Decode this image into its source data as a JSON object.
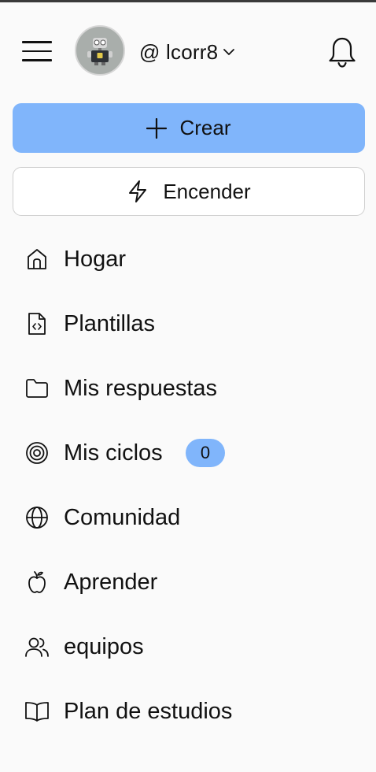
{
  "header": {
    "menu_icon": "hamburger-menu-icon",
    "avatar_icon": "robot-avatar-icon",
    "username": "@ lcorr8",
    "dropdown_icon": "chevron-down-icon",
    "notifications_icon": "bell-icon"
  },
  "actions": {
    "create_label": "Crear",
    "create_icon": "plus-icon",
    "power_label": "Encender",
    "power_icon": "lightning-bolt-icon",
    "accent_color": "#80b5fb"
  },
  "nav": {
    "items": [
      {
        "label": "Hogar",
        "icon": "home-icon"
      },
      {
        "label": "Plantillas",
        "icon": "code-file-icon"
      },
      {
        "label": "Mis respuestas",
        "icon": "folder-icon"
      },
      {
        "label": "Mis ciclos",
        "icon": "spiral-icon",
        "badge": "0"
      },
      {
        "label": "Comunidad",
        "icon": "globe-icon"
      },
      {
        "label": "Aprender",
        "icon": "apple-icon"
      },
      {
        "label": "equipos",
        "icon": "users-icon"
      },
      {
        "label": "Plan de estudios",
        "icon": "open-book-icon"
      }
    ]
  }
}
